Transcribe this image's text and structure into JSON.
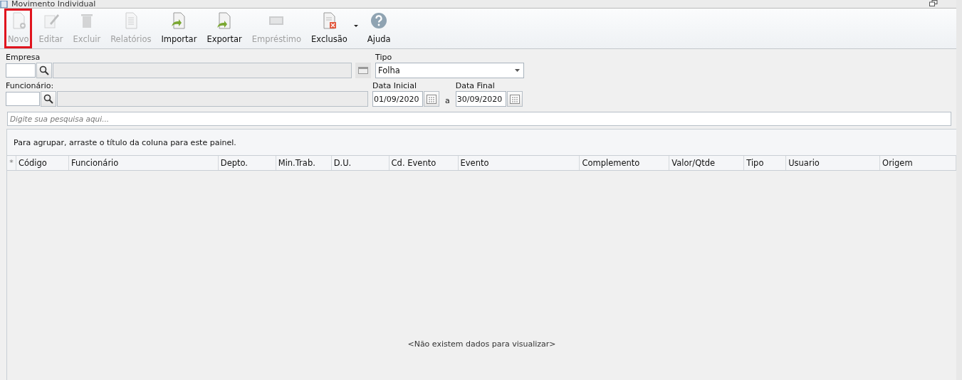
{
  "window": {
    "title": "Movimento Individual"
  },
  "toolbar": [
    {
      "label": "Novo",
      "kind": "new",
      "disabled": true,
      "highlighted": true,
      "dropdown": false
    },
    {
      "label": "Editar",
      "kind": "edit",
      "disabled": true,
      "highlighted": false,
      "dropdown": false
    },
    {
      "label": "Excluir",
      "kind": "trash",
      "disabled": true,
      "highlighted": false,
      "dropdown": false
    },
    {
      "label": "Relatórios",
      "kind": "report",
      "disabled": true,
      "highlighted": false,
      "dropdown": false
    },
    {
      "label": "Importar",
      "kind": "import",
      "disabled": false,
      "highlighted": false,
      "dropdown": false
    },
    {
      "label": "Exportar",
      "kind": "export",
      "disabled": false,
      "highlighted": false,
      "dropdown": false
    },
    {
      "label": "Empréstimo",
      "kind": "money",
      "disabled": true,
      "highlighted": false,
      "dropdown": false
    },
    {
      "label": "Exclusão",
      "kind": "delete",
      "disabled": false,
      "highlighted": false,
      "dropdown": true
    },
    {
      "label": "Ajuda",
      "kind": "help",
      "disabled": false,
      "highlighted": false,
      "dropdown": false
    }
  ],
  "form": {
    "empresa_label": "Empresa",
    "tipo_label": "Tipo",
    "tipo_value": "Folha",
    "funcionario_label": "Funcionário:",
    "data_inicial_label": "Data Inicial",
    "data_inicial": "01/09/2020",
    "separator": "a",
    "data_final_label": "Data Final",
    "data_final": "30/09/2020"
  },
  "search": {
    "placeholder": "Digite sua pesquisa aqui..."
  },
  "grid": {
    "group_hint": "Para agrupar, arraste o título da coluna para este painel.",
    "marker": "*",
    "columns": [
      "Código",
      "Funcionário",
      "Depto.",
      "Min.Trab.",
      "D.U.",
      "Cd. Evento",
      "Evento",
      "Complemento",
      "Valor/Qtde",
      "Tipo",
      "Usuario",
      "Origem"
    ],
    "empty_text": "<Não existem dados para visualizar>"
  }
}
